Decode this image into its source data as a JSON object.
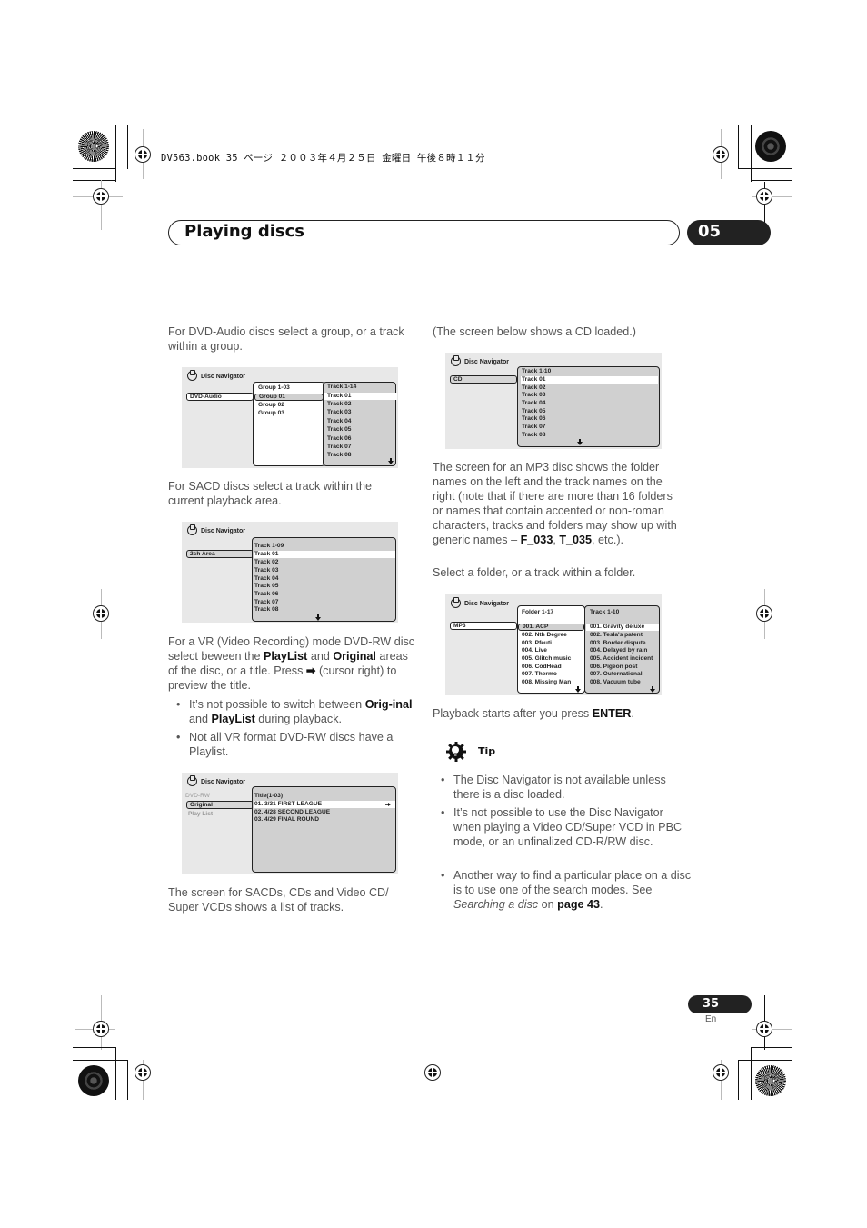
{
  "print_header": "DV563.book  35 ページ  ２００３年４月２５日  金曜日  午後８時１１分",
  "section": {
    "title": "Playing discs",
    "chapter": "05"
  },
  "left_column": {
    "dvd_audio_intro": "For DVD-Audio discs select a group, or a track within a group.",
    "sacd_intro": "For SACD discs select a track within the current playback area.",
    "vr_intro": {
      "p1": "For a VR (Video Recording) mode DVD-RW disc select beween the ",
      "b1": "PlayList",
      "p2": " and ",
      "b2": "Original",
      "p3": " areas of the disc, or a title. Press ",
      "arrow": "➡",
      "p4": " (cursor right) to preview the title."
    },
    "vr_bullets": [
      {
        "t1": "It’s not possible to switch between ",
        "b1": "Orig-inal",
        "t2": " and ",
        "b2": "PlayList",
        "t3": " during playback."
      },
      {
        "t1": "Not all VR format DVD-RW discs have a Playlist."
      }
    ],
    "sacd_cd_outro": "The screen for SACDs, CDs and Video CD/ Super VCDs shows a list of tracks."
  },
  "right_column": {
    "cd_intro": "(The screen below shows a CD loaded.)",
    "mp3_intro": {
      "p1": "The screen for an MP3 disc shows the folder names on the left and the track names on the right (note that if there are more than 16 folders or names that contain accented or non-roman characters, tracks and folders may show up with generic names – ",
      "b1": "F_033",
      "p2": ", ",
      "b2": "T_035",
      "p3": ", etc.)."
    },
    "mp3_select": "Select a folder, or a track within a folder.",
    "playback": {
      "p1": "Playback starts after you press ",
      "b1": "ENTER",
      "p2": "."
    },
    "tip": {
      "icon": "lightbulb-gear-icon",
      "label": "Tip",
      "bullets": [
        {
          "t1": "The Disc Navigator is not available unless there is a disc loaded."
        },
        {
          "t1": "It’s not possible to use the Disc Navigator when playing a Video CD/Super VCD in PBC mode, or an unfinalized CD-R/RW disc."
        },
        {
          "t1": "Another way to find a particular place on a disc is to use one of the search modes. See ",
          "i1": "Searching a disc",
          "t2": " on ",
          "b1": "page 43",
          "t3": "."
        }
      ]
    }
  },
  "screens": {
    "dvd_audio": {
      "title": "Disc Navigator",
      "disc_type": "DVD-Audio",
      "group_header": "Group 1-03",
      "groups": [
        "Group 01",
        "Group 02",
        "Group 03"
      ],
      "track_header": "Track 1-14",
      "tracks": [
        "Track 01",
        "Track 02",
        "Track 03",
        "Track 04",
        "Track 05",
        "Track 06",
        "Track 07",
        "Track 08"
      ]
    },
    "sacd": {
      "title": "Disc Navigator",
      "area": "2ch Area",
      "track_header": "Track 1-09",
      "tracks": [
        "Track 01",
        "Track 02",
        "Track 03",
        "Track 04",
        "Track 05",
        "Track 06",
        "Track 07",
        "Track 08"
      ]
    },
    "dvd_rw": {
      "title": "Disc Navigator",
      "disc_type": "DVD-RW",
      "areas": [
        "Original",
        "Play List"
      ],
      "title_header": "Title(1-03)",
      "titles": [
        "01. 3/31 FIRST LEAGUE",
        "02. 4/28 SECOND LEAGUE",
        "03. 4/29 FINAL ROUND"
      ]
    },
    "cd": {
      "title": "Disc Navigator",
      "disc_type": "CD",
      "track_header": "Track 1-10",
      "tracks": [
        "Track 01",
        "Track 02",
        "Track 03",
        "Track 04",
        "Track 05",
        "Track 06",
        "Track 07",
        "Track 08"
      ]
    },
    "mp3": {
      "title": "Disc Navigator",
      "disc_type": "MP3",
      "folder_header": "Folder 1-17",
      "folders": [
        "001. ACP",
        "002. Nth Degree",
        "003. Pfeuti",
        "004. Live",
        "005. Glitch music",
        "006. CodHead",
        "007. Thermo",
        "008. Missing Man"
      ],
      "track_header": "Track 1-10",
      "tracks": [
        "001. Gravity deluxe",
        "002. Tesla's patent",
        "003. Border dispute",
        "004. Delayed by rain",
        "005. Accident incident",
        "006. Pigeon post",
        "007. Outernational",
        "008. Vacuum tube"
      ]
    }
  },
  "footer": {
    "page_number": "35",
    "language": "En"
  }
}
